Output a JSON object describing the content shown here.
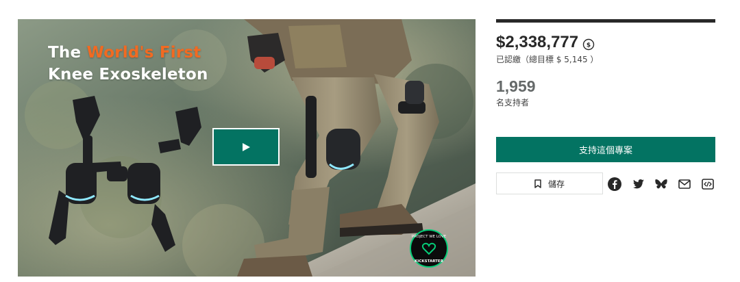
{
  "hero": {
    "title_line1_prefix": "The ",
    "title_line1_accent": "World's First",
    "title_line2": "Knee Exoskeleton",
    "accent_color": "#f26a21",
    "badge_text_top": "PROJECT WE LOVE",
    "badge_text_bottom": "KICKSTARTER",
    "play_icon": "play-icon"
  },
  "campaign": {
    "pledged_amount": "$2,338,777",
    "currency_icon": "currency-conversion-icon",
    "pledged_subtitle": "已認繳（總目標 $ 5,145 ）",
    "progress_fraction": 1.0,
    "backers_count": "1,959",
    "backers_label": "名支持者"
  },
  "actions": {
    "back_project_label": "支持這個專案",
    "save_label": "儲存",
    "save_icon": "bookmark-icon",
    "share_icons": [
      "facebook-icon",
      "twitter-icon",
      "bluesky-icon",
      "email-icon",
      "embed-icon"
    ]
  },
  "colors": {
    "primary_green": "#037362",
    "text_dark": "#282828",
    "text_muted": "#656969"
  }
}
